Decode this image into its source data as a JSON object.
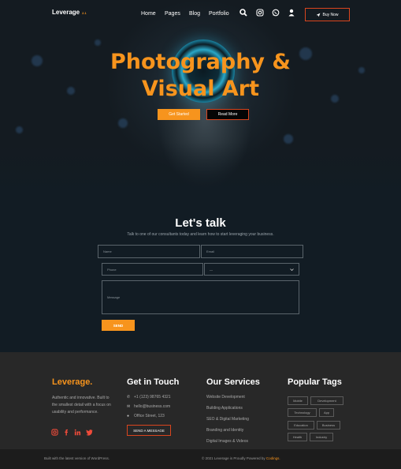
{
  "nav": {
    "logo": "Leverage",
    "logo_version": "2.1",
    "links": [
      "Home",
      "Pages",
      "Blog",
      "Portfolio"
    ],
    "icons": [
      "search-icon",
      "instagram-icon",
      "whatsapp-icon",
      "user-icon"
    ],
    "buy_label": "Buy Now"
  },
  "hero": {
    "title_line1": "Photography &",
    "title_line2": "Visual Art",
    "start_label": "Get Started",
    "read_label": "Read More",
    "accent": "#f7941d"
  },
  "contact": {
    "title": "Let's talk",
    "subtitle": "Talk to one of our consultants today and learn how to start leveraging your business.",
    "name_placeholder": "Name",
    "email_placeholder": "Email",
    "phone_placeholder": "Phone",
    "select_value": "---",
    "message_placeholder": "Message",
    "send_label": "SEND"
  },
  "footer": {
    "logo": "Leverage.",
    "about": "Authentic and innovative. Built to the smallest detail with a focus on usability and performance.",
    "social": [
      "instagram-icon",
      "facebook-icon",
      "linkedin-icon",
      "twitter-icon"
    ],
    "contact_title": "Get in Touch",
    "phone": "+1 (123) 98765 4321",
    "email": "hello@business.com",
    "address": "Office Street, 123",
    "message_label": "SEND A MESSAGE",
    "services_title": "Our Services",
    "services": [
      "Website Development",
      "Building Applications",
      "SEO & Digital Marketing",
      "Branding and Identity",
      "Digital Images & Videos"
    ],
    "tags_title": "Popular Tags",
    "tags": [
      "Mobile",
      "Development",
      "Technology",
      "App",
      "Education",
      "Business",
      "Health",
      "Industry"
    ]
  },
  "bottom": {
    "left": "Built with the latest version of WordPress.",
    "right_prefix": "© 2021 Leverage is Proudly Powered by",
    "right_brand": "Codings."
  }
}
